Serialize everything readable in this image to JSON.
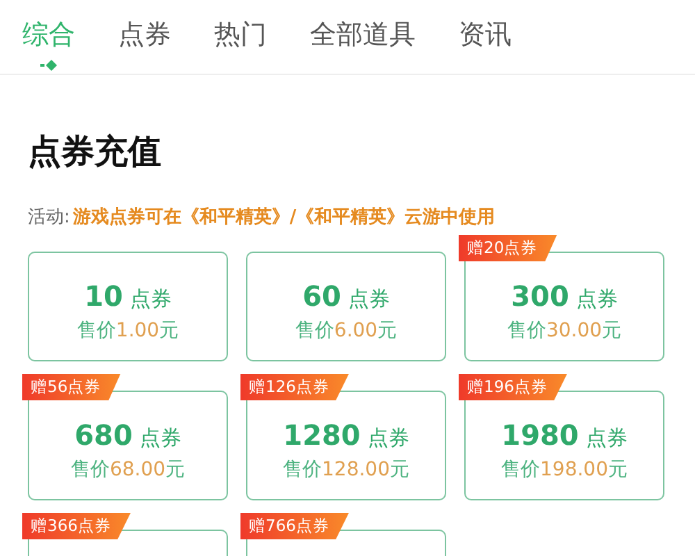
{
  "tabs": [
    {
      "label": "综合",
      "selected": true
    },
    {
      "label": "点券",
      "selected": false
    },
    {
      "label": "热门",
      "selected": false
    },
    {
      "label": "全部道具",
      "selected": false
    },
    {
      "label": "资讯",
      "selected": false
    }
  ],
  "section": {
    "title": "点券充值",
    "activity_label": "活动:",
    "activity_text": "游戏点券可在《和平精英》/《和平精英》云游中使用"
  },
  "cards": [
    {
      "amount": "10",
      "unit": "点券",
      "price_label": "售价",
      "price": "1.00",
      "currency": "元"
    },
    {
      "amount": "60",
      "unit": "点券",
      "price_label": "售价",
      "price": "6.00",
      "currency": "元"
    },
    {
      "badge": "赠20点券",
      "amount": "300",
      "unit": "点券",
      "price_label": "售价",
      "price": "30.00",
      "currency": "元"
    },
    {
      "badge": "赠56点券",
      "amount": "680",
      "unit": "点券",
      "price_label": "售价",
      "price": "68.00",
      "currency": "元"
    },
    {
      "badge": "赠126点券",
      "amount": "1280",
      "unit": "点券",
      "price_label": "售价",
      "price": "128.00",
      "currency": "元"
    },
    {
      "badge": "赠196点券",
      "amount": "1980",
      "unit": "点券",
      "price_label": "售价",
      "price": "198.00",
      "currency": "元"
    },
    {
      "badge": "赠366点券"
    },
    {
      "badge": "赠766点券"
    }
  ]
}
